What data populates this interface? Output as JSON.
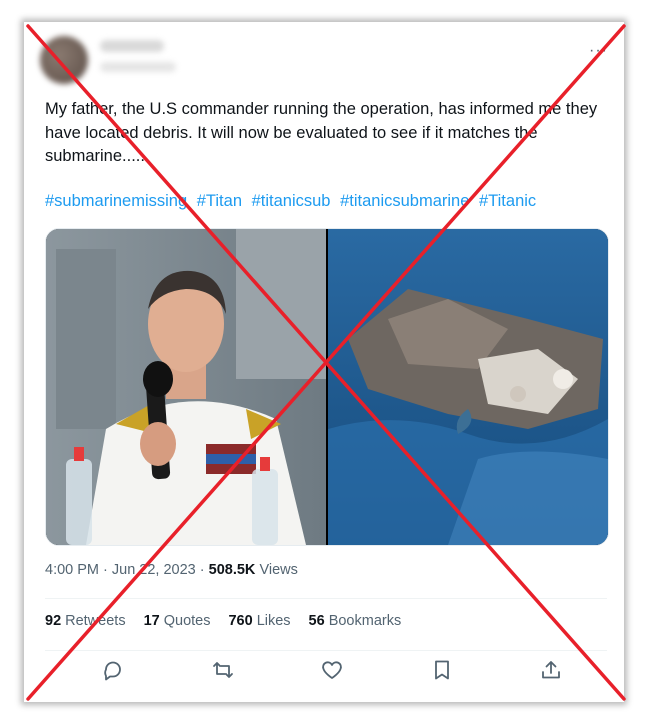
{
  "tweet": {
    "text": "My father, the U.S commander running the operation, has informed me they have located debris. It will now be evaluated to see if it matches the submarine.....",
    "hashtags": [
      "#submarinemissing",
      "#Titan",
      "#titanicsub",
      "#titanicsubmarine",
      "#Titanic"
    ],
    "more_icon": "···",
    "time": "4:00 PM · Jun 22, 2023",
    "views_count": "508.5K",
    "views_label": "Views"
  },
  "stats": [
    {
      "count": "92",
      "label": "Retweets"
    },
    {
      "count": "17",
      "label": "Quotes"
    },
    {
      "count": "760",
      "label": "Likes"
    },
    {
      "count": "56",
      "label": "Bookmarks"
    }
  ],
  "actions": [
    "reply-icon",
    "retweet-icon",
    "like-icon",
    "bookmark-icon",
    "share-icon"
  ],
  "colors": {
    "accent": "#1d9bf0",
    "cross": "#e8202a",
    "text": "#0f1419",
    "muted": "#536471"
  }
}
